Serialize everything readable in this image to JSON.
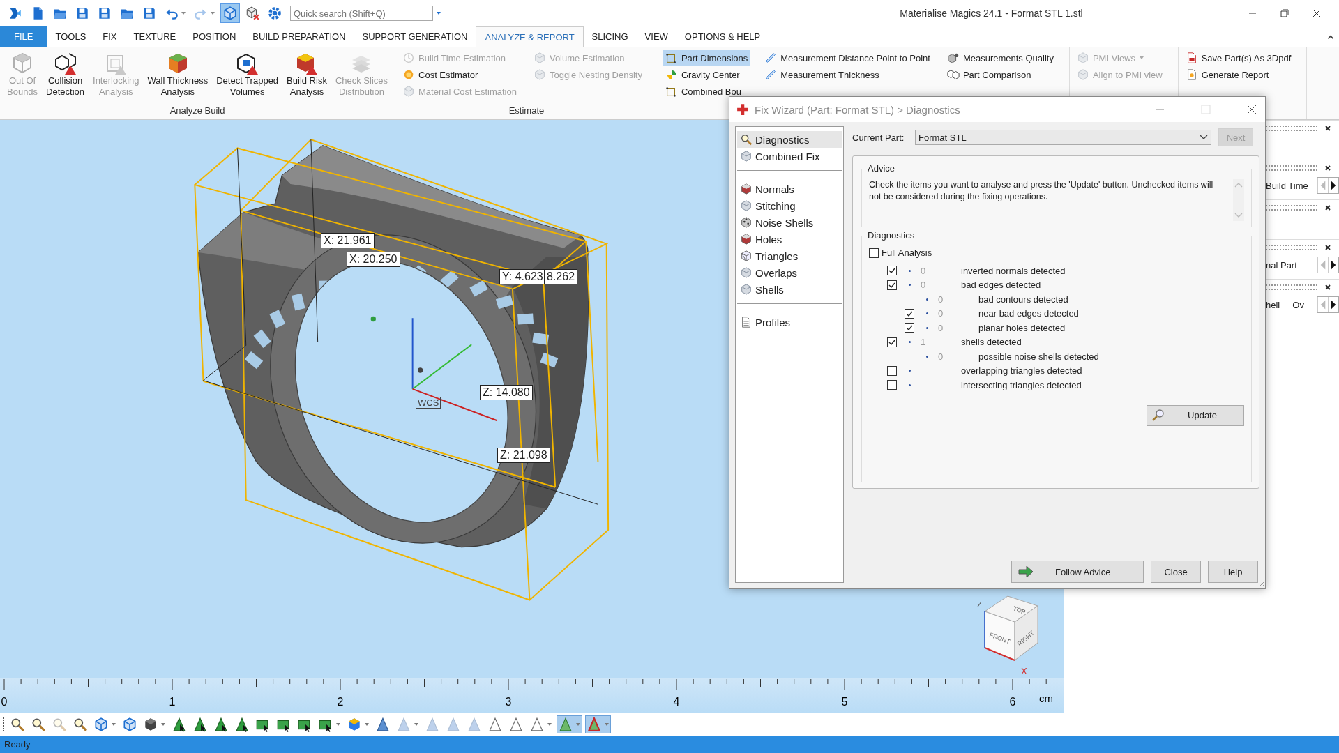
{
  "window": {
    "title": "Materialise Magics 24.1 - Format STL 1.stl"
  },
  "quick_access": [
    {
      "kind": "logo",
      "selected": false,
      "disabled": false,
      "menu": false
    },
    {
      "kind": "document",
      "selected": false,
      "disabled": false,
      "menu": false
    },
    {
      "kind": "folder",
      "selected": false,
      "disabled": false,
      "menu": false
    },
    {
      "kind": "disk",
      "selected": false,
      "disabled": false,
      "menu": false
    },
    {
      "kind": "disk",
      "selected": false,
      "disabled": false,
      "menu": false
    },
    {
      "kind": "folder",
      "selected": false,
      "disabled": false,
      "menu": false
    },
    {
      "kind": "disk",
      "selected": false,
      "disabled": false,
      "menu": false
    },
    {
      "kind": "undo",
      "selected": false,
      "disabled": false,
      "menu": true
    },
    {
      "kind": "redo",
      "selected": false,
      "disabled": true,
      "menu": true
    },
    {
      "kind": "cube",
      "selected": true,
      "disabled": false,
      "menu": false
    },
    {
      "kind": "cubex",
      "selected": false,
      "disabled": false,
      "menu": false
    },
    {
      "kind": "gear",
      "selected": false,
      "disabled": false,
      "menu": false
    }
  ],
  "search": {
    "placeholder": "Quick search (Shift+Q)"
  },
  "tabs": [
    {
      "label": "FILE",
      "kind": "file",
      "selected": false
    },
    {
      "label": "TOOLS",
      "kind": "tab",
      "selected": false
    },
    {
      "label": "FIX",
      "kind": "tab",
      "selected": false
    },
    {
      "label": "TEXTURE",
      "kind": "tab",
      "selected": false
    },
    {
      "label": "POSITION",
      "kind": "tab",
      "selected": false
    },
    {
      "label": "BUILD PREPARATION",
      "kind": "tab",
      "selected": false
    },
    {
      "label": "SUPPORT GENERATION",
      "kind": "tab",
      "selected": false
    },
    {
      "label": "ANALYZE & REPORT",
      "kind": "tab",
      "selected": true
    },
    {
      "label": "SLICING",
      "kind": "tab",
      "selected": false
    },
    {
      "label": "VIEW",
      "kind": "tab",
      "selected": false
    },
    {
      "label": "OPTIONS & HELP",
      "kind": "tab",
      "selected": false
    }
  ],
  "ribbon": {
    "groups": [
      {
        "kind": "large",
        "label": "Analyze Build",
        "buttons": [
          {
            "label": "Out Of\nBounds",
            "kind": "wire",
            "disabled": true
          },
          {
            "label": "Collision\nDetection",
            "kind": "collision",
            "disabled": false
          },
          {
            "label": "Interlocking\nAnalysis",
            "kind": "lattice",
            "disabled": true
          },
          {
            "label": "Wall Thickness\nAnalysis",
            "kind": "wall",
            "disabled": false
          },
          {
            "label": "Detect Trapped\nVolumes",
            "kind": "trapped",
            "disabled": false
          },
          {
            "label": "Build Risk\nAnalysis",
            "kind": "risk",
            "disabled": false
          },
          {
            "label": "Check Slices\nDistribution",
            "kind": "slices",
            "disabled": true
          }
        ]
      },
      {
        "kind": "small",
        "label": "Estimate",
        "columns": [
          [
            {
              "label": "Build Time Estimation",
              "kind": "clock",
              "disabled": true,
              "selected": false,
              "menu": false
            },
            {
              "label": "Cost Estimator",
              "kind": "coin",
              "disabled": false,
              "selected": false,
              "menu": false
            },
            {
              "label": "Material Cost Estimation",
              "kind": "navcube",
              "disabled": true,
              "selected": false,
              "menu": false
            }
          ],
          [
            {
              "label": "Volume Estimation",
              "kind": "navcube",
              "disabled": true,
              "selected": false,
              "menu": false
            },
            {
              "label": "Toggle Nesting Density",
              "kind": "navcube",
              "disabled": true,
              "selected": false,
              "menu": false
            }
          ]
        ]
      },
      {
        "kind": "small",
        "columns": [
          [
            {
              "label": "Part Dimensions",
              "kind": "bbox",
              "disabled": false,
              "selected": true,
              "menu": false
            },
            {
              "label": "Gravity Center",
              "kind": "gravity",
              "disabled": false,
              "selected": false,
              "menu": false
            },
            {
              "label": "Combined Bou",
              "kind": "bbox",
              "disabled": false,
              "selected": false,
              "menu": false
            }
          ],
          [
            {
              "label": "Measurement Distance Point to Point",
              "kind": "ruler",
              "disabled": false,
              "selected": false,
              "menu": false
            },
            {
              "label": "Measurement Thickness",
              "kind": "ruler",
              "disabled": false,
              "selected": false,
              "menu": false
            }
          ],
          [
            {
              "label": "Measurements Quality",
              "kind": "gearcube",
              "disabled": false,
              "selected": false,
              "menu": false
            },
            {
              "label": "Part Comparison",
              "kind": "compare",
              "disabled": false,
              "selected": false,
              "menu": false
            }
          ]
        ]
      },
      {
        "kind": "small",
        "columns": [
          [
            {
              "label": "PMI Views",
              "kind": "navcube",
              "disabled": true,
              "selected": false,
              "menu": true
            },
            {
              "label": "Align to PMI view",
              "kind": "navcube",
              "disabled": true,
              "selected": false,
              "menu": false
            }
          ]
        ]
      },
      {
        "kind": "small",
        "columns": [
          [
            {
              "label": "Save Part(s) As 3Dpdf",
              "kind": "pdf",
              "disabled": false,
              "selected": false,
              "menu": false
            },
            {
              "label": "Generate Report",
              "kind": "report",
              "disabled": false,
              "selected": false,
              "menu": false
            }
          ]
        ]
      }
    ]
  },
  "viewport": {
    "measurements": [
      "X: 21.961",
      "X: 20.250",
      "Y: 4.623",
      "8.262",
      "Z: 14.080",
      "Z: 21.098"
    ],
    "axis_label": "WCS",
    "view_cube": {
      "faces": [
        "TOP",
        "FRONT",
        "RIGHT"
      ],
      "axes": [
        "Z",
        "X"
      ]
    }
  },
  "ruler": {
    "labels": [
      "0",
      "1",
      "2",
      "3",
      "4",
      "5",
      "6"
    ],
    "unit": "cm"
  },
  "bottom_toolbar": [
    {
      "kind": "magnifier",
      "selected": false,
      "disabled": false,
      "menu": false
    },
    {
      "kind": "magnifier",
      "selected": false,
      "disabled": false,
      "menu": false
    },
    {
      "kind": "magnifier",
      "selected": false,
      "disabled": true,
      "menu": false
    },
    {
      "kind": "magnifier",
      "selected": false,
      "disabled": false,
      "menu": false
    },
    {
      "kind": "cube",
      "selected": false,
      "disabled": false,
      "menu": true
    },
    {
      "kind": "cube",
      "selected": false,
      "disabled": false,
      "menu": false
    },
    {
      "kind": "solid",
      "selected": false,
      "disabled": false,
      "menu": true
    },
    {
      "kind": "greentri",
      "selected": false,
      "disabled": false,
      "menu": false
    },
    {
      "kind": "greentri",
      "selected": false,
      "disabled": false,
      "menu": false
    },
    {
      "kind": "greentri",
      "selected": false,
      "disabled": false,
      "menu": false
    },
    {
      "kind": "greentri",
      "selected": false,
      "disabled": false,
      "menu": false
    },
    {
      "kind": "shape",
      "selected": false,
      "disabled": false,
      "menu": false
    },
    {
      "kind": "shape",
      "selected": false,
      "disabled": false,
      "menu": false
    },
    {
      "kind": "shape",
      "selected": false,
      "disabled": false,
      "menu": false
    },
    {
      "kind": "shape",
      "selected": false,
      "disabled": false,
      "menu": true
    },
    {
      "kind": "colorcube",
      "selected": false,
      "disabled": false,
      "menu": true
    },
    {
      "kind": "triangle",
      "selected": false,
      "disabled": false,
      "menu": false
    },
    {
      "kind": "triangle",
      "selected": false,
      "disabled": true,
      "menu": true
    },
    {
      "kind": "triangle",
      "selected": false,
      "disabled": true,
      "menu": false
    },
    {
      "kind": "triangle",
      "selected": false,
      "disabled": true,
      "menu": false
    },
    {
      "kind": "triangle",
      "selected": false,
      "disabled": true,
      "menu": false
    },
    {
      "kind": "outline",
      "selected": false,
      "disabled": false,
      "menu": false
    },
    {
      "kind": "outline",
      "selected": false,
      "disabled": false,
      "menu": false
    },
    {
      "kind": "outline",
      "selected": false,
      "disabled": false,
      "menu": true
    },
    {
      "kind": "selgreen",
      "selected": true,
      "disabled": false,
      "menu": true
    },
    {
      "kind": "selred",
      "selected": true,
      "disabled": false,
      "menu": true
    }
  ],
  "side_panel": {
    "sections": [
      {
        "kind": "empty"
      },
      {
        "kind": "row",
        "label": "Build Time"
      },
      {
        "kind": "empty"
      },
      {
        "kind": "row",
        "label": "nal Part"
      },
      {
        "kind": "row",
        "label": "hell",
        "value": "Ov"
      }
    ]
  },
  "dialog": {
    "title": "Fix Wizard (Part: Format STL) > Diagnostics",
    "nav": [
      {
        "items": [
          {
            "label": "Diagnostics",
            "kind": "magnifier",
            "selected": true
          },
          {
            "label": "Combined Fix",
            "kind": "navcube",
            "selected": false
          }
        ]
      },
      {
        "items": [
          {
            "label": "Normals",
            "kind": "redcube",
            "selected": false
          },
          {
            "label": "Stitching",
            "kind": "navcube",
            "selected": false
          },
          {
            "label": "Noise Shells",
            "kind": "dotcube",
            "selected": false
          },
          {
            "label": "Holes",
            "kind": "redcube",
            "selected": false
          },
          {
            "label": "Triangles",
            "kind": "wirecube",
            "selected": false
          },
          {
            "label": "Overlaps",
            "kind": "navcube",
            "selected": false
          },
          {
            "label": "Shells",
            "kind": "navcube",
            "selected": false
          }
        ]
      },
      {
        "items": [
          {
            "label": "Profiles",
            "kind": "doc",
            "selected": false
          }
        ]
      }
    ],
    "current_part_label": "Current Part:",
    "current_part": "Format STL",
    "next": {
      "label": "Next",
      "disabled": true
    },
    "advice": {
      "title": "Advice",
      "text": "Check the items you want to analyse and press the 'Update' button. Unchecked items will not be considered during the fixing operations."
    },
    "diagnostics": {
      "title": "Diagnostics",
      "full_analysis": {
        "label": "Full Analysis",
        "checked": false
      },
      "rows": [
        {
          "kind": "check",
          "checked": true,
          "count": "0",
          "label": "inverted normals detected"
        },
        {
          "kind": "check",
          "checked": true,
          "count": "0",
          "label": "bad edges detected",
          "children": [
            {
              "kind": "info",
              "count": "0",
              "label": "bad contours detected"
            },
            {
              "kind": "check",
              "checked": true,
              "count": "0",
              "label": "near bad edges detected"
            },
            {
              "kind": "check",
              "checked": true,
              "count": "0",
              "label": "planar holes detected"
            }
          ]
        },
        {
          "kind": "check",
          "checked": true,
          "count": "1",
          "label": "shells detected",
          "children": [
            {
              "kind": "info",
              "count": "0",
              "label": "possible noise shells detected"
            }
          ]
        },
        {
          "kind": "check",
          "checked": false,
          "label": "overlapping triangles detected"
        },
        {
          "kind": "check",
          "checked": false,
          "label": "intersecting triangles detected"
        }
      ],
      "update": "Update"
    },
    "buttons": [
      "Follow Advice",
      "Close",
      "Help"
    ]
  },
  "status_bar": {
    "text": "Ready"
  }
}
